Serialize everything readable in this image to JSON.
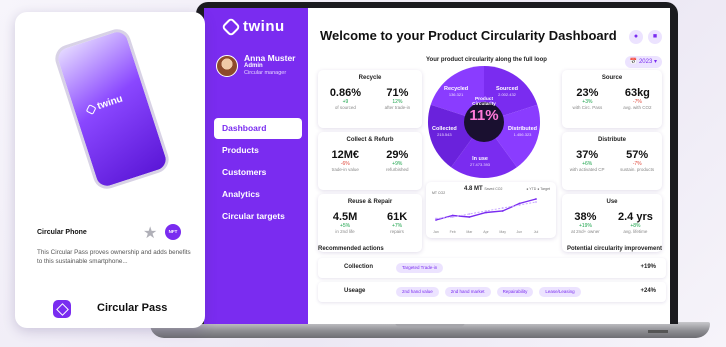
{
  "app": {
    "logo": "twinu"
  },
  "user": {
    "name": "Anna Muster",
    "role": "Admin",
    "title": "Circular manager"
  },
  "nav": [
    {
      "label": "Dashboard"
    },
    {
      "label": "Products"
    },
    {
      "label": "Customers"
    },
    {
      "label": "Analytics"
    },
    {
      "label": "Circular targets"
    }
  ],
  "header": {
    "title": "Welcome to your Product Circularity Dashboard",
    "year": "2023"
  },
  "loop": {
    "subtitle": "Your product circularity along the full loop",
    "center_title": "Product Circularity",
    "center_value": "11%",
    "segments": [
      {
        "label": "Recycled",
        "value": "136.321"
      },
      {
        "label": "Sourced",
        "value": "2.002.432"
      },
      {
        "label": "Distributed",
        "value": "1.456.323"
      },
      {
        "label": "In use",
        "value": "27.473.393"
      },
      {
        "label": "Collected",
        "value": "215.543"
      }
    ]
  },
  "cards": {
    "recycle": {
      "title": "Recycle",
      "metrics": [
        {
          "value": "0.86%",
          "delta": "+9",
          "label": "of sourced"
        },
        {
          "value": "71%",
          "delta": "12%",
          "label": "after trade-in"
        }
      ]
    },
    "collect": {
      "title": "Collect & Refurb",
      "metrics": [
        {
          "value": "12M€",
          "delta": "-6%",
          "label": "trade-in value"
        },
        {
          "value": "29%",
          "delta": "+9%",
          "label": "refurbished"
        }
      ]
    },
    "reuse": {
      "title": "Reuse & Repair",
      "metrics": [
        {
          "value": "4.5M",
          "delta": "+5%",
          "label": "in 2nd life"
        },
        {
          "value": "61K",
          "delta": "+7%",
          "label": "repairs"
        }
      ]
    },
    "source": {
      "title": "Source",
      "metrics": [
        {
          "value": "23%",
          "delta": "+3%",
          "label": "with Circ. Pass"
        },
        {
          "value": "63kg",
          "delta": "-7%",
          "label": "avg. with CO2"
        }
      ]
    },
    "distribute": {
      "title": "Distribute",
      "metrics": [
        {
          "value": "37%",
          "delta": "+6%",
          "label": "with activated CP"
        },
        {
          "value": "57%",
          "delta": "-7%",
          "label": "sustain. products"
        }
      ]
    },
    "use": {
      "title": "Use",
      "metrics": [
        {
          "value": "38%",
          "delta": "+19%",
          "label": "at 2nd+ owner"
        },
        {
          "value": "2.4 yrs",
          "delta": "+8%",
          "label": "avg. lifetime"
        }
      ]
    }
  },
  "chart_data": {
    "type": "line",
    "title": "4.8 MT",
    "subtitle": "Saved CO2",
    "ylabel": "MT CO2",
    "categories": [
      "Jan",
      "Feb",
      "Mar",
      "Apr",
      "May",
      "Jun",
      "Jul"
    ],
    "series": [
      {
        "name": "YTD",
        "values": [
          3.4,
          3.7,
          3.6,
          3.9,
          4.0,
          4.5,
          4.8
        ]
      },
      {
        "name": "Target",
        "values": [
          3.5,
          3.6,
          3.8,
          4.0,
          4.2,
          4.4,
          4.6
        ]
      }
    ],
    "colors": {
      "ytd": "#7a2cf0",
      "target": "#c8a8ff"
    }
  },
  "actions": {
    "left": "Recommended actions",
    "right": "Potential circularity improvement",
    "rows": [
      {
        "label": "Collection",
        "tags": [
          "Targeted Trade-in"
        ],
        "value": "+19%"
      },
      {
        "label": "Useage",
        "tags": [
          "2nd hand value",
          "2nd hand market",
          "Repairability",
          "Lease/Leasing"
        ],
        "value": "+24%"
      }
    ]
  },
  "pass": {
    "product": "Circular Phone",
    "nft": "NFT",
    "description": "This Circular Pass proves ownership and adds benefits to this sustainable smartphone...",
    "name": "Circular Pass",
    "phone_logo": "twinu"
  }
}
